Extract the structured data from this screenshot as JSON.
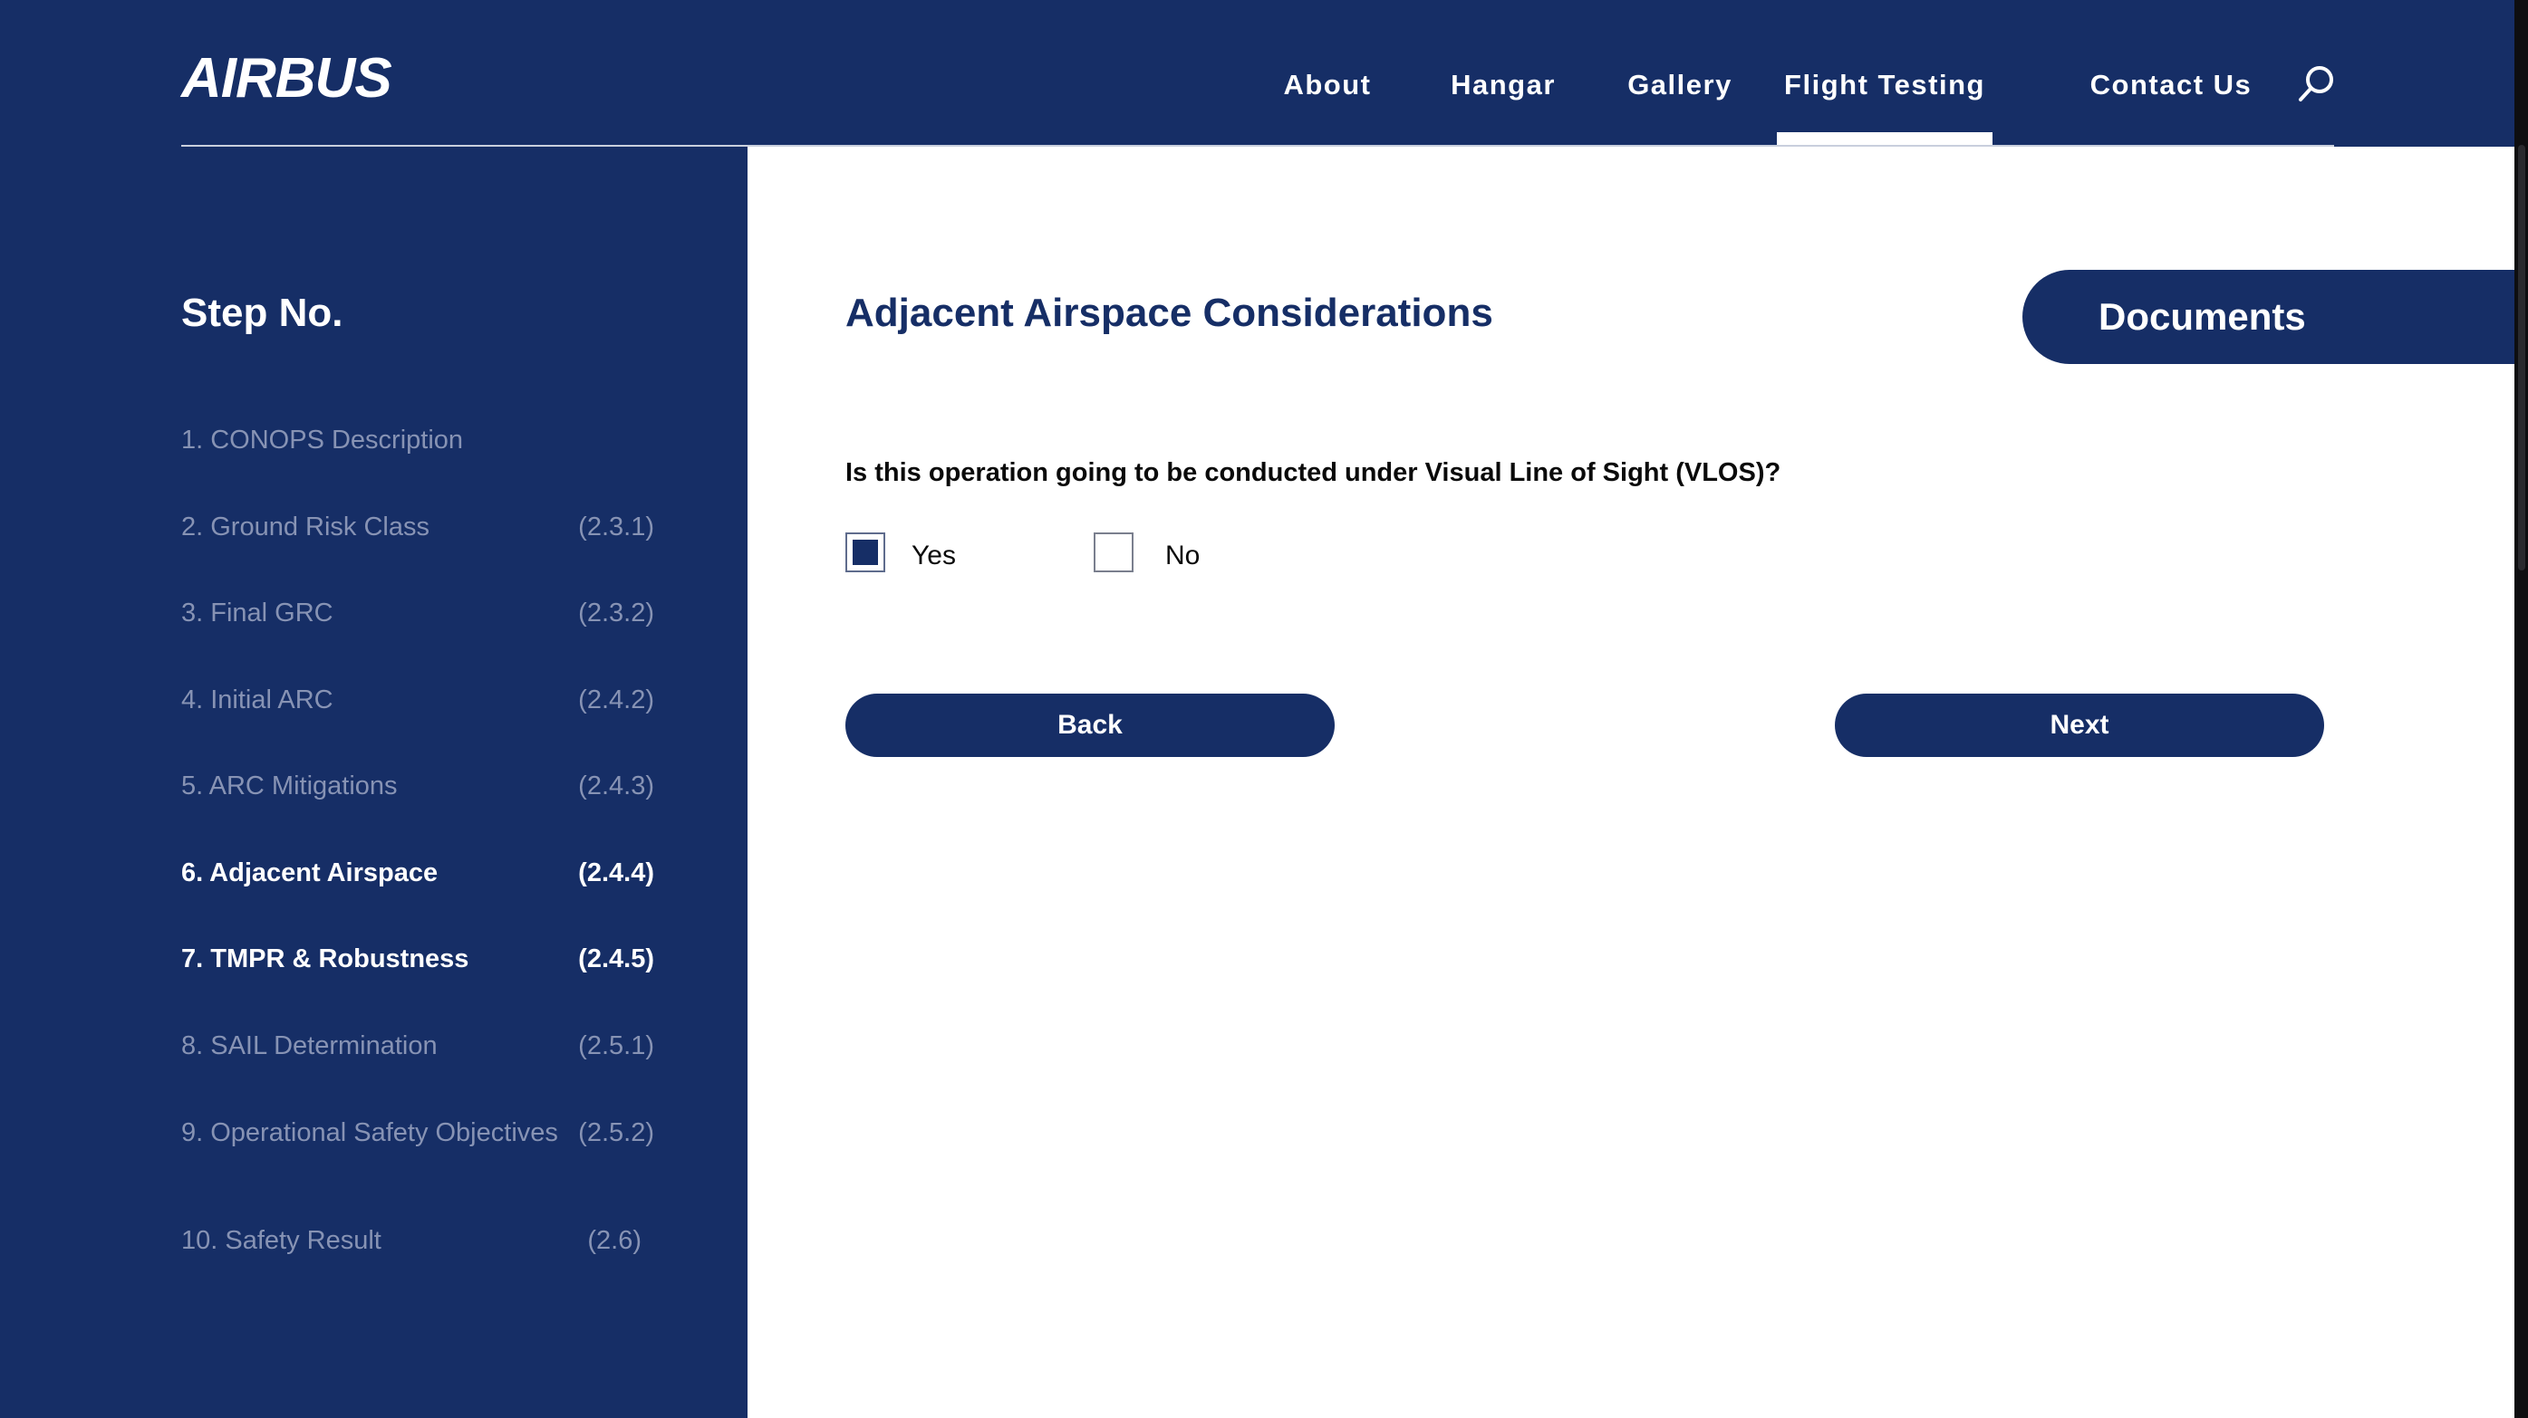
{
  "header": {
    "logo": "AIRBUS",
    "nav": [
      "About",
      "Hangar",
      "Gallery",
      "Flight Testing",
      "Contact Us"
    ],
    "active_nav": "Flight Testing",
    "search_icon": "search-icon"
  },
  "sidebar": {
    "title": "Step No.",
    "steps": [
      {
        "label": "1. CONOPS Description",
        "code": ""
      },
      {
        "label": "2. Ground Risk Class",
        "code": "(2.3.1)"
      },
      {
        "label": "3. Final GRC",
        "code": "(2.3.2)"
      },
      {
        "label": "4. Initial ARC",
        "code": "(2.4.2)"
      },
      {
        "label": "5. ARC Mitigations",
        "code": "(2.4.3)"
      },
      {
        "label": "6. Adjacent Airspace",
        "code": "(2.4.4)"
      },
      {
        "label": "7. TMPR & Robustness",
        "code": "(2.4.5)"
      },
      {
        "label": "8. SAIL Determination",
        "code": "(2.5.1)"
      },
      {
        "label": "9. Operational Safety Objectives",
        "code": "(2.5.2)"
      },
      {
        "label": "10. Safety Result",
        "code": "(2.6)"
      }
    ]
  },
  "main": {
    "title": "Adjacent Airspace Considerations",
    "documents_label": "Documents",
    "question": "Is this operation going to be conducted under Visual Line of Sight (VLOS)?",
    "options": [
      {
        "label": "Yes",
        "checked": true
      },
      {
        "label": "No",
        "checked": false
      }
    ],
    "back_label": "Back",
    "next_label": "Next"
  },
  "colors": {
    "brand_navy": "#162e66",
    "inactive_step": "#8793b4",
    "white": "#ffffff"
  }
}
